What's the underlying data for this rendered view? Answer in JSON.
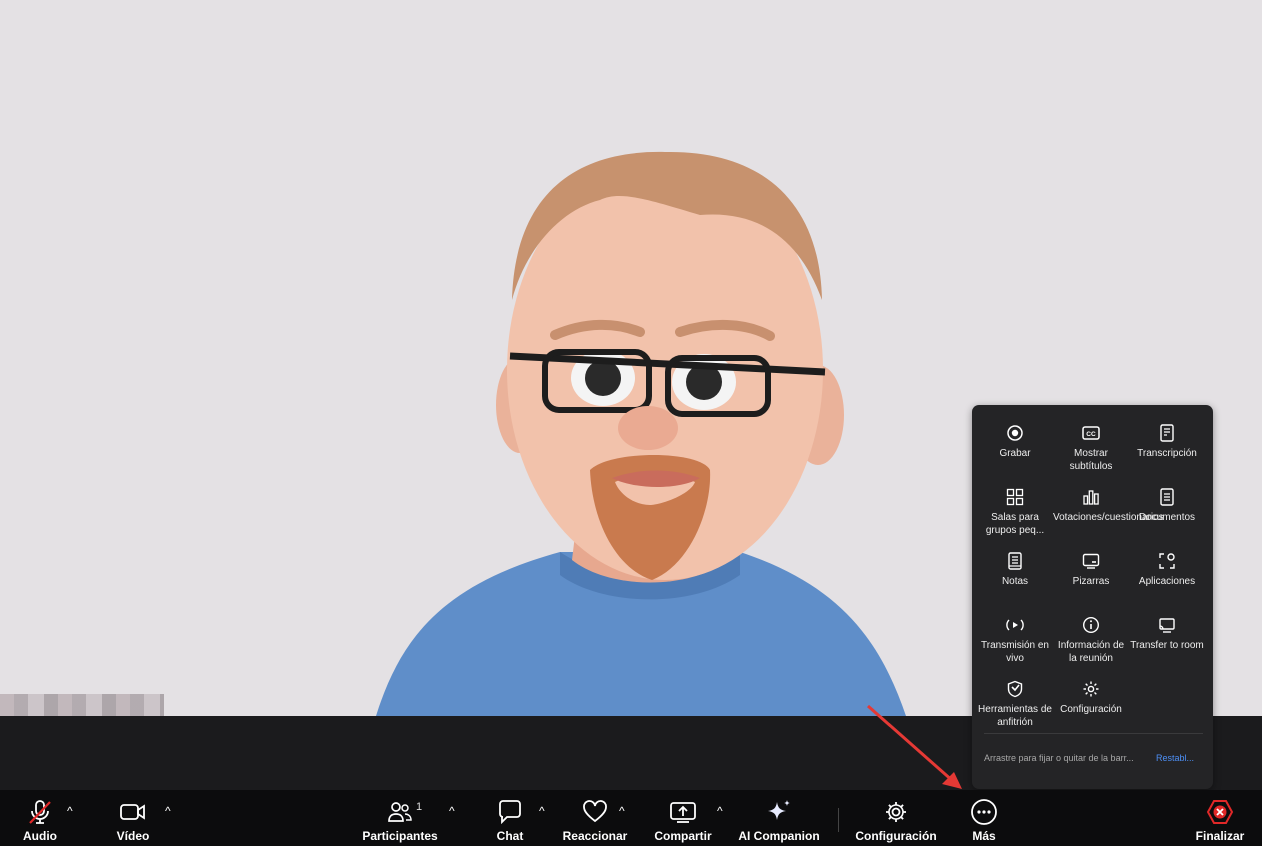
{
  "toolbar": {
    "audio": "Audio",
    "video": "Vídeo",
    "participants": "Participantes",
    "participants_count": "1",
    "chat": "Chat",
    "react": "Reaccionar",
    "share": "Compartir",
    "ai_companion": "AI Companion",
    "settings": "Configuración",
    "more": "Más",
    "end": "Finalizar",
    "caret": "^"
  },
  "more_menu": {
    "items": [
      {
        "label": "Grabar",
        "icon": "record-icon"
      },
      {
        "label": "Mostrar subtítulos",
        "icon": "captions-icon"
      },
      {
        "label": "Transcripción",
        "icon": "transcript-icon"
      },
      {
        "label": "Salas para grupos peq...",
        "icon": "breakout-rooms-icon"
      },
      {
        "label": "Votaciones/cuestionarios",
        "icon": "polls-icon"
      },
      {
        "label": "Documentos",
        "icon": "documents-icon"
      },
      {
        "label": "Notas",
        "icon": "notes-icon"
      },
      {
        "label": "Pizarras",
        "icon": "whiteboard-icon"
      },
      {
        "label": "Aplicaciones",
        "icon": "apps-icon"
      },
      {
        "label": "Transmisión en vivo",
        "icon": "live-stream-icon"
      },
      {
        "label": "Información de la reunión",
        "icon": "info-icon"
      },
      {
        "label": "Transfer to room",
        "icon": "transfer-room-icon"
      },
      {
        "label": "Herramientas de anfitrión",
        "icon": "host-tools-icon"
      },
      {
        "label": "Configuración",
        "icon": "gear-icon"
      }
    ],
    "footer_text": "Arrastre para fijar o quitar de la barr...",
    "footer_link": "Restabl..."
  },
  "colors": {
    "toolbar_bg": "#0c0c0d",
    "menu_bg": "#242426",
    "end_red": "#e02828",
    "link_blue": "#4d8ff5",
    "annotation_arrow": "#e53935"
  }
}
